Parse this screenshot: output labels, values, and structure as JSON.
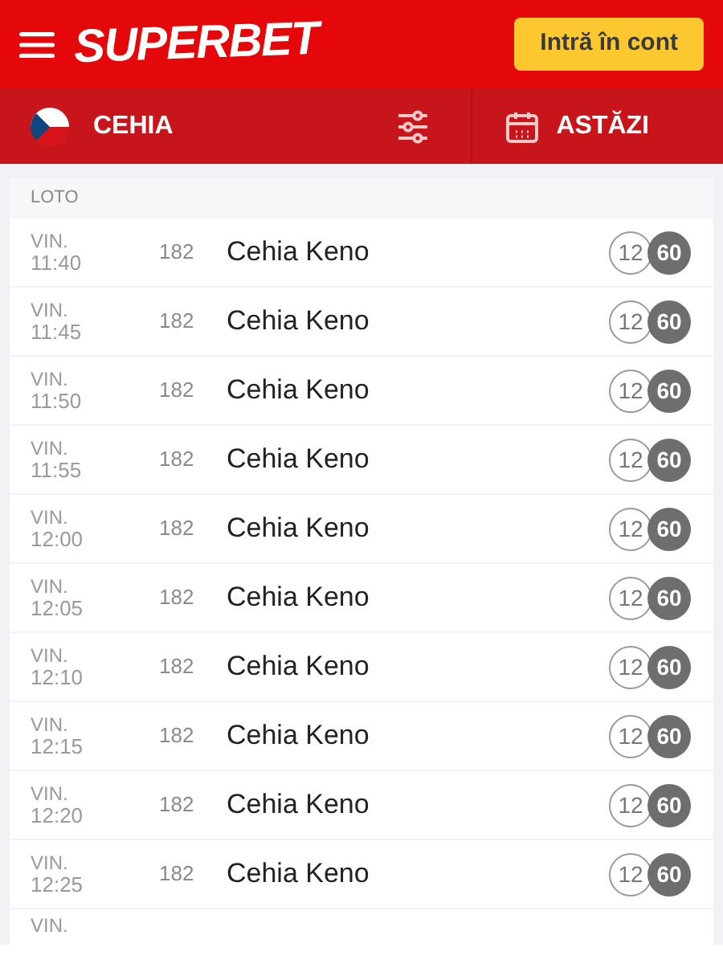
{
  "header": {
    "logo": "SUPERBET",
    "login_button": "Intră în cont"
  },
  "filter_bar": {
    "country": "CEHIA",
    "date": "ASTĂZI"
  },
  "section": {
    "title": "LOTO"
  },
  "rows": [
    {
      "day": "VIN.",
      "time": "11:40",
      "number": "182",
      "name": "Cehia Keno",
      "pick": "12",
      "total": "60"
    },
    {
      "day": "VIN.",
      "time": "11:45",
      "number": "182",
      "name": "Cehia Keno",
      "pick": "12",
      "total": "60"
    },
    {
      "day": "VIN.",
      "time": "11:50",
      "number": "182",
      "name": "Cehia Keno",
      "pick": "12",
      "total": "60"
    },
    {
      "day": "VIN.",
      "time": "11:55",
      "number": "182",
      "name": "Cehia Keno",
      "pick": "12",
      "total": "60"
    },
    {
      "day": "VIN.",
      "time": "12:00",
      "number": "182",
      "name": "Cehia Keno",
      "pick": "12",
      "total": "60"
    },
    {
      "day": "VIN.",
      "time": "12:05",
      "number": "182",
      "name": "Cehia Keno",
      "pick": "12",
      "total": "60"
    },
    {
      "day": "VIN.",
      "time": "12:10",
      "number": "182",
      "name": "Cehia Keno",
      "pick": "12",
      "total": "60"
    },
    {
      "day": "VIN.",
      "time": "12:15",
      "number": "182",
      "name": "Cehia Keno",
      "pick": "12",
      "total": "60"
    },
    {
      "day": "VIN.",
      "time": "12:20",
      "number": "182",
      "name": "Cehia Keno",
      "pick": "12",
      "total": "60"
    },
    {
      "day": "VIN.",
      "time": "12:25",
      "number": "182",
      "name": "Cehia Keno",
      "pick": "12",
      "total": "60"
    },
    {
      "day": "VIN."
    }
  ]
}
